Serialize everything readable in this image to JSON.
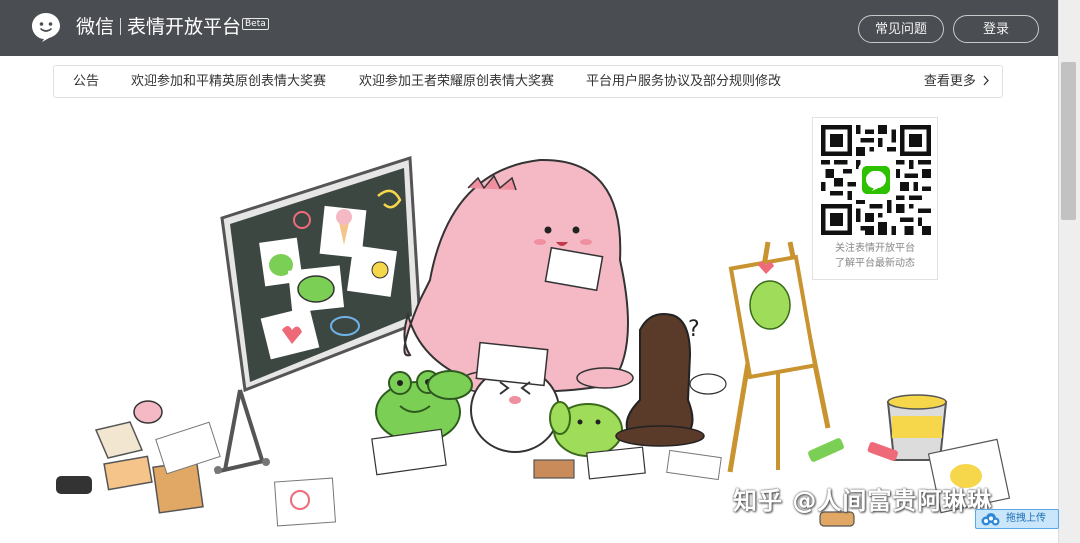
{
  "header": {
    "logo_icon": "wechat-sticker-logo-icon",
    "app_name": "微信",
    "product_name": "表情开放平台",
    "beta_label": "Beta",
    "faq_label": "常见问题",
    "login_label": "登录",
    "bg_color": "#4a4d52"
  },
  "notice": {
    "title": "公告",
    "items": [
      "欢迎参加和平精英原创表情大奖赛",
      "欢迎参加王者荣耀原创表情大奖赛",
      "平台用户服务协议及部分规则修改"
    ],
    "more_label": "查看更多",
    "more_icon": "chevron-right-icon"
  },
  "qr": {
    "line1": "关注表情开放平台",
    "line2": "了解平台最新动态"
  },
  "watermark": "知乎 @人间富贵阿琳琳",
  "upload": {
    "label": "拖拽上传",
    "icon": "cloud-upload-icon"
  },
  "colors": {
    "dino_pink": "#f4b9c4",
    "frog_green": "#7ccf55",
    "chalkboard": "#3d4742",
    "horse_brown": "#5a3b2a"
  }
}
